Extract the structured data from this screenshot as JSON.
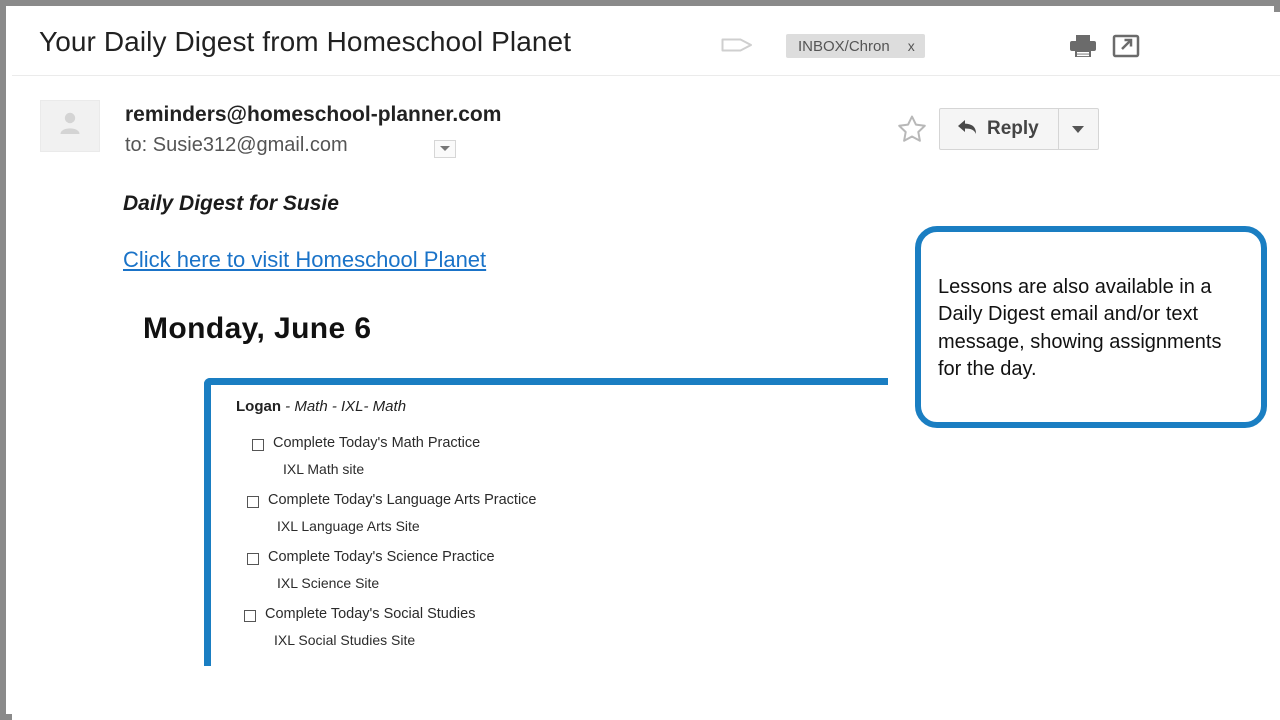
{
  "window": {
    "border_color": "#8a8a8a"
  },
  "mail_header": {
    "subject": "Your Daily Digest from Homeschool Planet",
    "label_tag_icon": "label-tag-icon",
    "label_chip": {
      "text": "INBOX/Chron",
      "remove_label": "x"
    },
    "print_icon": "printer-icon",
    "popout_icon": "open-in-new-window-icon"
  },
  "sender": {
    "avatar_icon": "person-avatar-icon",
    "from_address": "reminders@homeschool-planner.com",
    "to_line": "to: Susie312@gmail.com",
    "recipient_dropdown_icon": "chevron-down-icon",
    "star_icon": "star-outline-icon",
    "reply_label": "Reply",
    "reply_arrow_icon": "reply-arrow-icon",
    "reply_more_icon": "chevron-down-icon"
  },
  "body": {
    "digest_title": "Daily Digest for Susie",
    "digest_link": "Click here to visit Homeschool Planet",
    "day_heading": "Monday, June 6",
    "student": {
      "name": "Logan",
      "course_path": " - Math - IXL- Math"
    },
    "tasks": [
      {
        "label": "Complete Today's Math Practice",
        "sub": "IXL Math site",
        "checked": false
      },
      {
        "label": "Complete Today's Language Arts Practice",
        "sub": "IXL Language Arts Site",
        "checked": false
      },
      {
        "label": "Complete Today's Science Practice",
        "sub": "IXL Science Site",
        "checked": false
      },
      {
        "label": "Complete Today's Social Studies",
        "sub": "IXL Social Studies Site",
        "checked": false
      }
    ]
  },
  "annotations": {
    "accent_color": "#1a7ec2",
    "callout_text": "Lessons are also available in a Daily Digest email and/or text message, showing assignments for the day."
  }
}
